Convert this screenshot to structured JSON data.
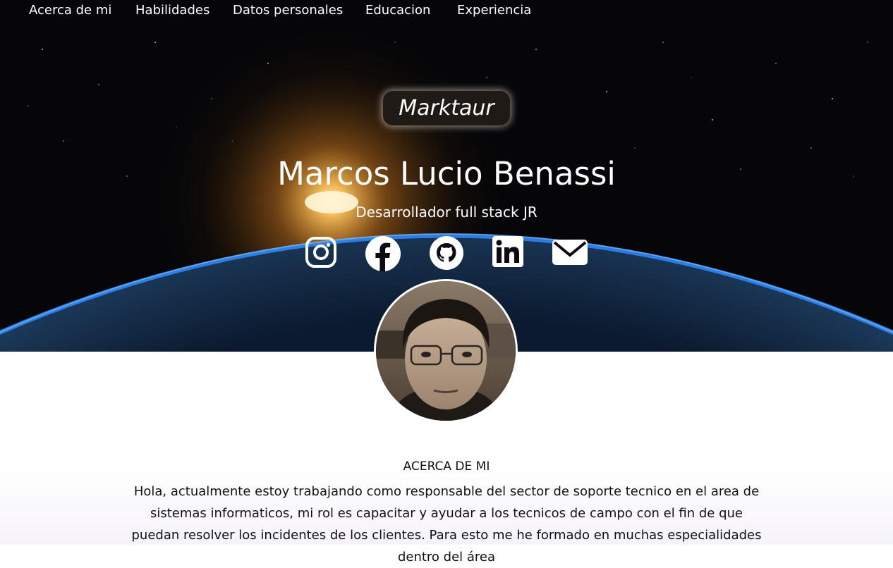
{
  "nav": {
    "items": [
      {
        "label": "Acerca de mi"
      },
      {
        "label": "Habilidades"
      },
      {
        "label": "Datos personales"
      },
      {
        "label": "Educacion"
      },
      {
        "label": "Experiencia"
      }
    ]
  },
  "hero": {
    "brand": "Marktaur",
    "name": "Marcos Lucio Benassi",
    "subtitle": "Desarrollador full stack JR",
    "social": [
      "instagram-icon",
      "facebook-icon",
      "github-icon",
      "linkedin-icon",
      "email-icon"
    ]
  },
  "about": {
    "title": "ACERCA DE MI",
    "text": "Hola, actualmente estoy trabajando como responsable del sector de soporte tecnico en el area de sistemas informaticos, mi rol es capacitar y ayudar a los tecnicos de campo con el fin de que puedan resolver los incidentes de los clientes. Para esto me he formado en muchas especialidades dentro del área"
  },
  "colors": {
    "hero_bg": "#050507",
    "earth_glow": "#2f8cff",
    "sun": "#ffb340",
    "text_light": "#ffffff",
    "text_dark": "#111111"
  }
}
